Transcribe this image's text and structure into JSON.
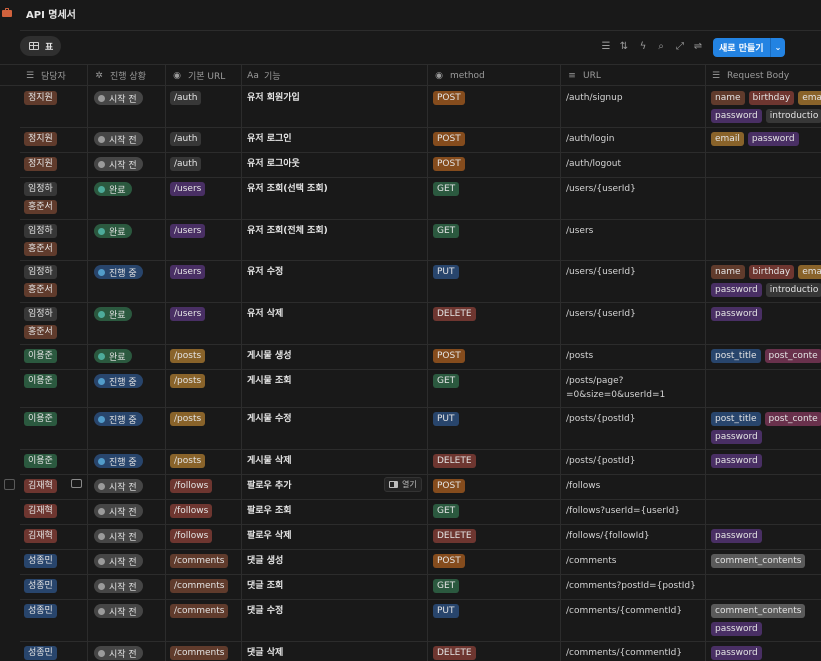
{
  "page": {
    "title": "API 명세서"
  },
  "view": {
    "tab_label": "표"
  },
  "toolbar": {
    "new_button": "새로 만들기",
    "icons": [
      "filter-icon",
      "sort-icon",
      "automation-icon",
      "search-icon",
      "expand-icon",
      "settings-icon"
    ]
  },
  "columns": {
    "assignee": "담당자",
    "status": "진행 상황",
    "base_url": "기본 URL",
    "feature": "기능",
    "method": "method",
    "url": "URL",
    "request_body": "Request Body"
  },
  "row_open_label": "열기",
  "colors": {
    "background": "#191919",
    "accent": "#2383e2",
    "status_todo": "#464646",
    "status_done": "#2b593f",
    "status_progress": "#28456c"
  },
  "rows": [
    {
      "assignees": [
        "정지원"
      ],
      "status": "시작 전",
      "base_url": "/auth",
      "feature": "유저 회원가입",
      "method": "POST",
      "url": "/auth/signup",
      "body": [
        "name",
        "birthday",
        "ema",
        "password",
        "introductio"
      ]
    },
    {
      "assignees": [
        "정지원"
      ],
      "status": "시작 전",
      "base_url": "/auth",
      "feature": "유저 로그인",
      "method": "POST",
      "url": "/auth/login",
      "body": [
        "email",
        "password"
      ]
    },
    {
      "assignees": [
        "정지원"
      ],
      "status": "시작 전",
      "base_url": "/auth",
      "feature": "유저 로그아웃",
      "method": "POST",
      "url": "/auth/logout",
      "body": []
    },
    {
      "assignees": [
        "임정하",
        "홍준서"
      ],
      "status": "완료",
      "base_url": "/users",
      "feature": "유저 조회(선택 조회)",
      "method": "GET",
      "url": "/users/{userId}",
      "body": []
    },
    {
      "assignees": [
        "임정하",
        "홍준서"
      ],
      "status": "완료",
      "base_url": "/users",
      "feature": "유저 조회(전체 조회)",
      "method": "GET",
      "url": "/users",
      "body": []
    },
    {
      "assignees": [
        "임정하",
        "홍준서"
      ],
      "status": "진행 중",
      "base_url": "/users",
      "feature": "유저 수정",
      "method": "PUT",
      "url": "/users/{userId}",
      "body": [
        "name",
        "birthday",
        "ema",
        "password",
        "introductio"
      ]
    },
    {
      "assignees": [
        "임정하",
        "홍준서"
      ],
      "status": "완료",
      "base_url": "/users",
      "feature": "유저 삭제",
      "method": "DELETE",
      "url": "/users/{userId}",
      "body": [
        "password"
      ]
    },
    {
      "assignees": [
        "이용준"
      ],
      "status": "완료",
      "base_url": "/posts",
      "feature": "게시물 생성",
      "method": "POST",
      "url": "/posts",
      "body": [
        "post_title",
        "post_conte"
      ]
    },
    {
      "assignees": [
        "이용준"
      ],
      "status": "진행 중",
      "base_url": "/posts",
      "feature": "게시물 조회",
      "method": "GET",
      "url_lines": [
        "/posts/page?",
        "=0&size=0&userId=1"
      ],
      "body": []
    },
    {
      "assignees": [
        "이용준"
      ],
      "status": "진행 중",
      "base_url": "/posts",
      "feature": "게시물 수정",
      "method": "PUT",
      "url": "/posts/{postId}",
      "body": [
        "post_title",
        "post_conte",
        "password"
      ]
    },
    {
      "assignees": [
        "이용준"
      ],
      "status": "진행 중",
      "base_url": "/posts",
      "feature": "게시물 삭제",
      "method": "DELETE",
      "url": "/posts/{postId}",
      "body": [
        "password"
      ]
    },
    {
      "assignees": [
        "김재혁"
      ],
      "status": "시작 전",
      "base_url": "/follows",
      "feature": "팔로우 추가",
      "method": "POST",
      "url": "/follows",
      "body": [],
      "hover": true
    },
    {
      "assignees": [
        "김재혁"
      ],
      "status": "시작 전",
      "base_url": "/follows",
      "feature": "팔로우 조회",
      "method": "GET",
      "url": "/follows?userId={userId}",
      "body": []
    },
    {
      "assignees": [
        "김재혁"
      ],
      "status": "시작 전",
      "base_url": "/follows",
      "feature": "팔로우 삭제",
      "method": "DELETE",
      "url": "/follows/{followId}",
      "body": [
        "password"
      ]
    },
    {
      "assignees": [
        "성종민"
      ],
      "status": "시작 전",
      "base_url": "/comments",
      "feature": "댓글 생성",
      "method": "POST",
      "url": "/comments",
      "body": [
        "comment_contents"
      ]
    },
    {
      "assignees": [
        "성종민"
      ],
      "status": "시작 전",
      "base_url": "/comments",
      "feature": "댓글 조회",
      "method": "GET",
      "url": "/comments?postId={postId}",
      "body": []
    },
    {
      "assignees": [
        "성종민"
      ],
      "status": "시작 전",
      "base_url": "/comments",
      "feature": "댓글 수정",
      "method": "PUT",
      "url": "/comments/{commentId}",
      "body": [
        "comment_contents",
        "password"
      ]
    },
    {
      "assignees": [
        "성종민"
      ],
      "status": "시작 전",
      "base_url": "/comments",
      "feature": "댓글 삭제",
      "method": "DELETE",
      "url": "/comments/{commentId}",
      "body": [
        "password"
      ]
    }
  ]
}
